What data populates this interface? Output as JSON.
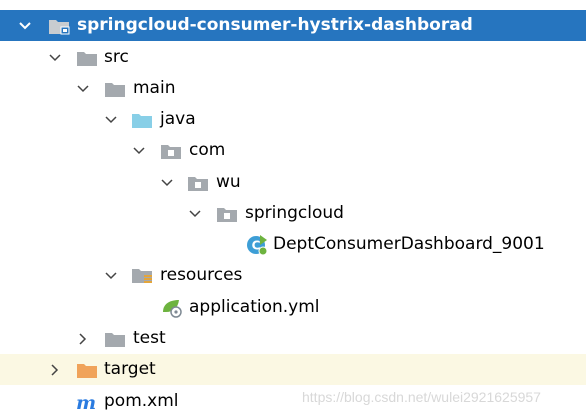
{
  "project_tree": {
    "rows": [
      {
        "label": "springcloud-consumer-hystrix-dashborad",
        "icon": "module-folder-icon",
        "state": "expanded",
        "level": 0,
        "selected": true
      },
      {
        "label": "src",
        "icon": "folder-icon",
        "state": "expanded",
        "level": 1
      },
      {
        "label": "main",
        "icon": "folder-icon",
        "state": "expanded",
        "level": 2
      },
      {
        "label": "java",
        "icon": "source-folder-icon",
        "state": "expanded",
        "level": 3
      },
      {
        "label": "com",
        "icon": "package-icon",
        "state": "expanded",
        "level": 4
      },
      {
        "label": "wu",
        "icon": "package-icon",
        "state": "expanded",
        "level": 5
      },
      {
        "label": "springcloud",
        "icon": "package-icon",
        "state": "expanded",
        "level": 6
      },
      {
        "label": "DeptConsumerDashboard_9001",
        "icon": "spring-boot-class-icon",
        "state": "leaf",
        "level": 7
      },
      {
        "label": "resources",
        "icon": "resources-folder-icon",
        "state": "expanded",
        "level": 3
      },
      {
        "label": "application.yml",
        "icon": "spring-config-file-icon",
        "state": "leaf",
        "level": 4
      },
      {
        "label": "test",
        "icon": "folder-icon",
        "state": "collapsed",
        "level": 2
      },
      {
        "label": "target",
        "icon": "excluded-folder-icon",
        "state": "collapsed",
        "level": 1,
        "highlighted": true
      },
      {
        "label": "pom.xml",
        "icon": "maven-icon",
        "state": "leaf",
        "level": 1
      }
    ]
  },
  "watermark": {
    "text": "https://blog.csdn.net/wulei2921625957"
  },
  "colors": {
    "selection": "#2675bf",
    "highlight_row": "#fbf8e3",
    "folder": "#a4a9ae",
    "source_folder": "#88cfe7",
    "excluded_folder": "#f0a35a",
    "maven": "#2a7be0",
    "spring_green": "#6db33f"
  }
}
